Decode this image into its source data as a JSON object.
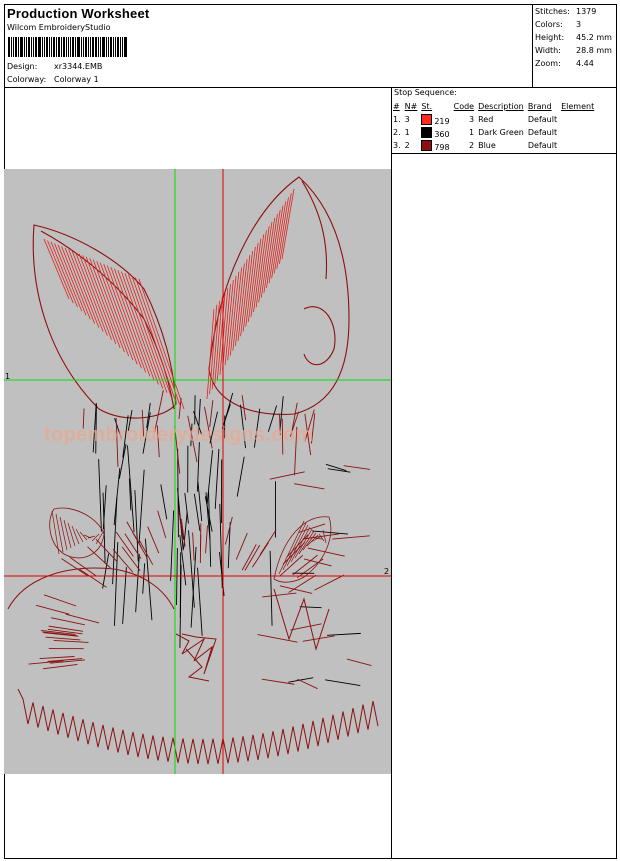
{
  "header": {
    "title": "Production Worksheet",
    "company": "Wilcom EmbroideryStudio",
    "design_label": "Design:",
    "design_value": "xr3344.EMB",
    "colorway_label": "Colorway:",
    "colorway_value": "Colorway 1"
  },
  "stats": [
    {
      "label": "Stitches:",
      "value": "1379"
    },
    {
      "label": "Colors:",
      "value": "3"
    },
    {
      "label": "Height:",
      "value": "45.2 mm"
    },
    {
      "label": "Width:",
      "value": "28.8 mm"
    },
    {
      "label": "Zoom:",
      "value": "4.44"
    }
  ],
  "stop_sequence": {
    "title": "Stop Sequence:",
    "columns": [
      "#",
      "N#",
      "St.",
      "Code",
      "Description",
      "Brand",
      "Element"
    ],
    "rows": [
      {
        "index": "1.",
        "n": "3",
        "color": "#ff2a1a",
        "st": "219",
        "code": "3",
        "description": "Red",
        "brand": "Default",
        "element": ""
      },
      {
        "index": "2.",
        "n": "1",
        "color": "#000000",
        "st": "360",
        "code": "1",
        "description": "Dark Green",
        "brand": "Default",
        "element": ""
      },
      {
        "index": "3.",
        "n": "2",
        "color": "#8b1010",
        "st": "798",
        "code": "2",
        "description": "Blue",
        "brand": "Default",
        "element": ""
      }
    ]
  },
  "preview": {
    "watermark": "topembroiderydesigns.com",
    "guide_label_1": "1",
    "guide_label_2": "2",
    "background_color": "#c0c0c0",
    "thread_colors": {
      "red": "#e0201a",
      "dark_red": "#8b1010",
      "black": "#000000"
    }
  }
}
